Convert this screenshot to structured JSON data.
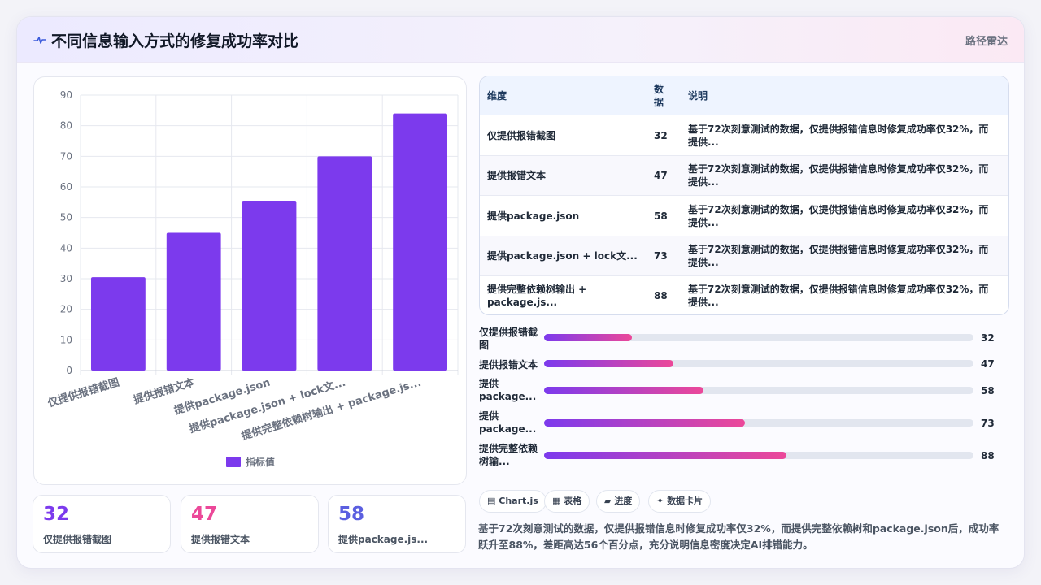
{
  "header": {
    "title": "不同信息输入方式的修复成功率对比",
    "route": "路径雷达"
  },
  "chart_data": {
    "type": "bar",
    "categories": [
      "仅提供报错截图",
      "提供报错文本",
      "提供package.json",
      "提供package.json + lock文...",
      "提供完整依赖树输出 + package.js..."
    ],
    "series": [
      {
        "name": "指标值",
        "values": [
          30.5,
          45,
          55.5,
          70,
          84
        ]
      }
    ],
    "ylim": [
      0,
      90
    ],
    "yticks": [
      0,
      10,
      20,
      30,
      40,
      50,
      60,
      70,
      80,
      90
    ],
    "grid": true,
    "legend": "bottom",
    "color": "#7c3aed"
  },
  "stats": [
    {
      "value": "32",
      "label": "仅提供报错截图",
      "color": "#7c3aed"
    },
    {
      "value": "47",
      "label": "提供报错文本",
      "color": "#ec4899"
    },
    {
      "value": "58",
      "label": "提供package.js...",
      "color": "#5b5fe0"
    }
  ],
  "table": {
    "headers": [
      "维度",
      "数据",
      "说明"
    ],
    "rows": [
      {
        "dim": "仅提供报错截图",
        "val": "32",
        "desc": "基于72次刻意测试的数据，仅提供报错信息时修复成功率仅32%，而提供..."
      },
      {
        "dim": "提供报错文本",
        "val": "47",
        "desc": "基于72次刻意测试的数据，仅提供报错信息时修复成功率仅32%，而提供..."
      },
      {
        "dim": "提供package.json",
        "val": "58",
        "desc": "基于72次刻意测试的数据，仅提供报错信息时修复成功率仅32%，而提供..."
      },
      {
        "dim": "提供package.json + lock文...",
        "val": "73",
        "desc": "基于72次刻意测试的数据，仅提供报错信息时修复成功率仅32%，而提供..."
      },
      {
        "dim": "提供完整依赖树输出 + package.js...",
        "val": "88",
        "desc": "基于72次刻意测试的数据，仅提供报错信息时修复成功率仅32%，而提供..."
      }
    ]
  },
  "progress": [
    {
      "label": "仅提供报错截图",
      "value": 32,
      "display": "32"
    },
    {
      "label": "提供报错文本",
      "value": 47,
      "display": "47"
    },
    {
      "label": "提供package...",
      "value": 58,
      "display": "58"
    },
    {
      "label": "提供package...",
      "value": 73,
      "display": "73"
    },
    {
      "label": "提供完整依赖树输...",
      "value": 88,
      "display": "88"
    }
  ],
  "progress_max": 156,
  "chips": [
    {
      "icon": "▤",
      "label": "Chart.js"
    },
    {
      "icon": "▦",
      "label": "表格"
    },
    {
      "icon": "▰",
      "label": "进度"
    },
    {
      "icon": "✦",
      "label": "数据卡片"
    }
  ],
  "summary": "基于72次刻意测试的数据，仅提供报错信息时修复成功率仅32%，而提供完整依赖树和package.json后，成功率跃升至88%，差距高达56个百分点，充分说明信息密度决定AI排错能力。"
}
